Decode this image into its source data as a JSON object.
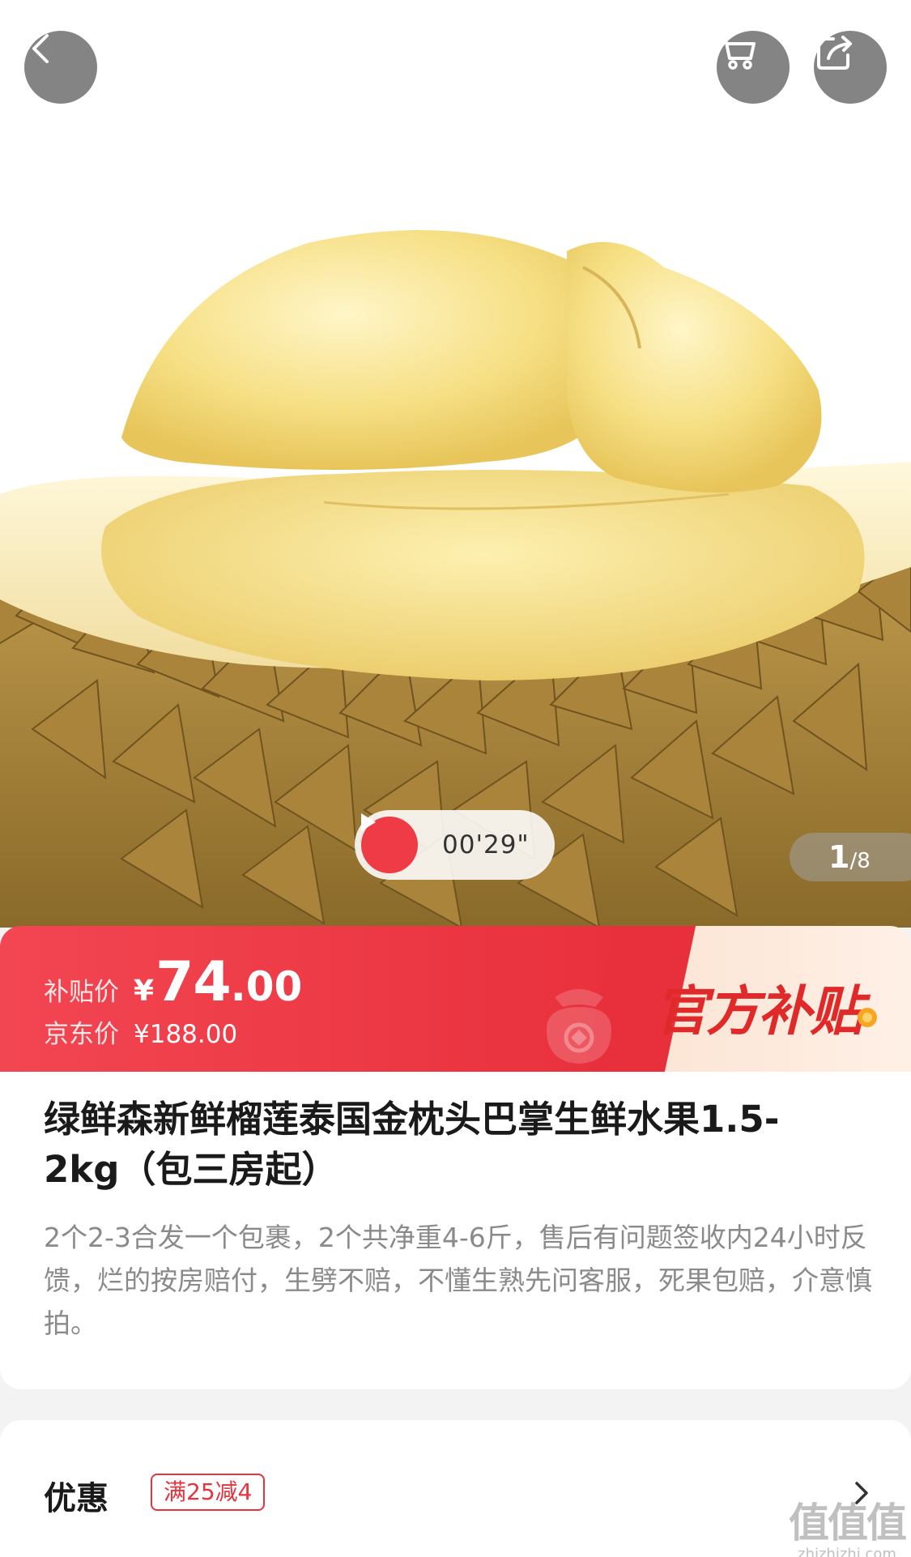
{
  "nav": {
    "back_icon": "chevron-left-icon",
    "cart_icon": "cart-icon",
    "share_icon": "share-icon"
  },
  "media": {
    "video_duration": "00'29\"",
    "page_current": "1",
    "page_separator": "/",
    "page_total": "8"
  },
  "price": {
    "subsidy_label": "补贴价",
    "subsidy_currency": "¥",
    "subsidy_integer": "74",
    "subsidy_decimal": ".00",
    "jd_label": "京东价",
    "jd_value": "¥188.00",
    "official_badge": "官方补贴"
  },
  "product": {
    "title": "绿鲜森新鲜榴莲泰国金枕头巴掌生鲜水果1.5-2kg（包三房起）",
    "description": "2个2-3合发一个包裹，2个共净重4-6斤，售后有问题签收内24小时反馈，烂的按房赔付，生劈不赔，不懂生熟先问客服，死果包赔，介意慎拍。"
  },
  "promo": {
    "label": "优惠",
    "tag": "满25减4"
  },
  "watermark": {
    "logo": "值值值",
    "url": "zhizhizhi.com"
  },
  "colors": {
    "accent_red": "#e8303c",
    "badge_bg": "#fbe3d2"
  }
}
